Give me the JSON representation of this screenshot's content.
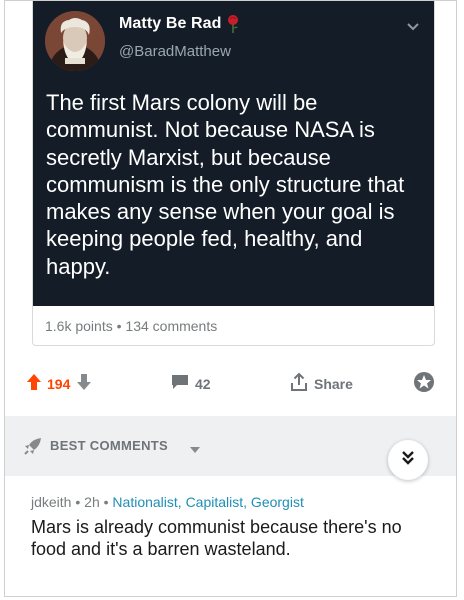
{
  "tweet": {
    "display_name": "Matty Be Rad",
    "handle": "@BaradMatthew",
    "text": "The first Mars colony will be communist. Not because NASA is secretly Marxist, but because communism is the only structure that makes any sense when your goal is keeping people fed, healthy, and happy.",
    "name_badge_icon": "rose-icon",
    "menu_icon": "chevron-down-icon"
  },
  "card": {
    "points": "1.6k points",
    "separator": "•",
    "comments": "134 comments"
  },
  "actions": {
    "upvote_count": "194",
    "comment_count": "42",
    "share_label": "Share"
  },
  "sort": {
    "label": "BEST COMMENTS"
  },
  "comment": {
    "author": "jdkeith",
    "separator": "•",
    "age": "2h",
    "flair": "Nationalist, Capitalist, Georgist",
    "body": "Mars is already communist because there's no food and it's a barren wasteland."
  },
  "colors": {
    "tweet_bg": "#141d27",
    "upvote": "#ff4500",
    "flair": "#1f8fb5",
    "sortbar_bg": "#eef0f2"
  }
}
